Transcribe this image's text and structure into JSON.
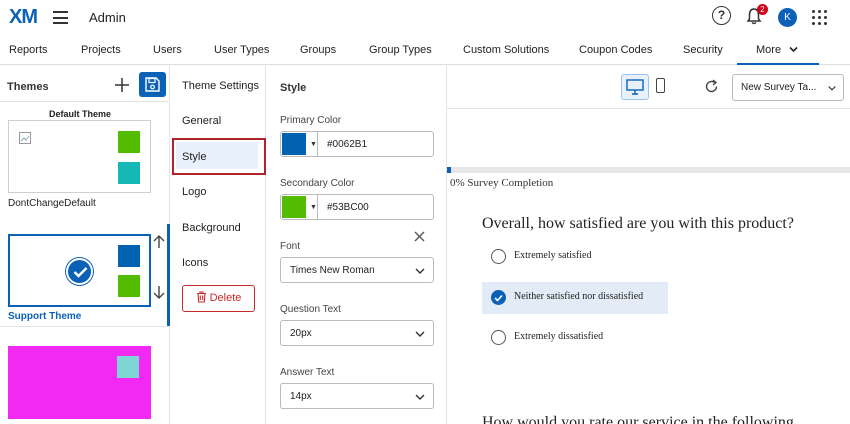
{
  "app": {
    "logo": "XM",
    "title": "Admin",
    "notification_count": "2",
    "avatar_initial": "K"
  },
  "nav": {
    "items": [
      "Reports",
      "Projects",
      "Users",
      "User Types",
      "Groups",
      "Group Types",
      "Custom Solutions",
      "Coupon Codes",
      "Security"
    ],
    "more_label": "More"
  },
  "themes": {
    "title": "Themes",
    "default_theme_label": "Default Theme",
    "cards": [
      {
        "name": "DontChangeDefault",
        "swatch_primary": "#53BC00",
        "swatch_secondary": "#16B8B5"
      },
      {
        "name": "Support Theme",
        "swatch_primary": "#0062B1",
        "swatch_secondary": "#53BC00",
        "selected": true
      },
      {
        "name": "",
        "background": "#F229F2",
        "swatch_secondary": "#7FD4D4"
      }
    ]
  },
  "settings_nav": {
    "items": [
      "Theme Settings",
      "General",
      "Style",
      "Logo",
      "Background",
      "Icons"
    ],
    "active": "Style",
    "delete_label": "Delete"
  },
  "style_form": {
    "title": "Style",
    "primary_color": {
      "label": "Primary Color",
      "value": "#0062B1"
    },
    "secondary_color": {
      "label": "Secondary Color",
      "value": "#53BC00"
    },
    "font": {
      "label": "Font",
      "value": "Times New Roman"
    },
    "question_text": {
      "label": "Question Text",
      "value": "20px"
    },
    "answer_text": {
      "label": "Answer Text",
      "value": "14px"
    }
  },
  "preview": {
    "survey_select": "New Survey Ta...",
    "progress_percent": 1,
    "progress_text": "0%  Survey Completion",
    "question": "Overall, how satisfied are you with this product?",
    "answers": [
      {
        "label": "Extremely satisfied",
        "selected": false
      },
      {
        "label": "Neither satisfied nor dissatisfied",
        "selected": true
      },
      {
        "label": "Extremely dissatisfied",
        "selected": false
      }
    ],
    "next_question": "How would you rate our service in the following"
  }
}
